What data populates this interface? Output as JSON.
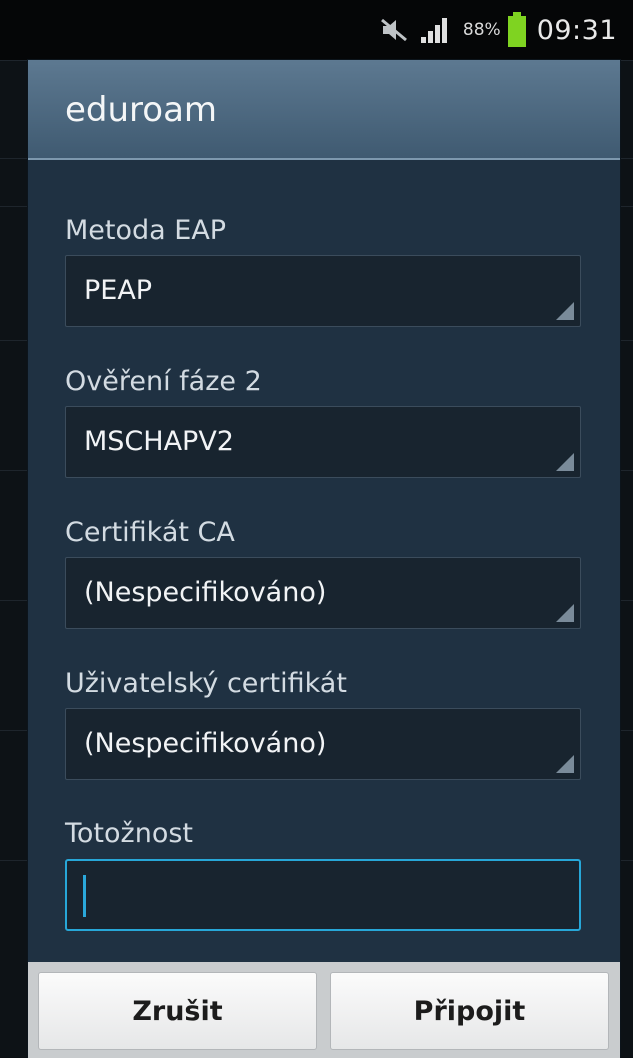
{
  "status_bar": {
    "battery_percent": "88%",
    "time": "09:31",
    "icons": [
      "mute-icon",
      "signal-icon",
      "battery-icon"
    ],
    "battery_color": "#7fd321"
  },
  "dialog": {
    "title": "eduroam",
    "fields": {
      "eap_method": {
        "label": "Metoda EAP",
        "value": "PEAP"
      },
      "phase2_auth": {
        "label": "Ověření fáze 2",
        "value": "MSCHAPV2"
      },
      "ca_certificate": {
        "label": "Certifikát CA",
        "value": "(Nespecifikováno)"
      },
      "user_certificate": {
        "label": "Uživatelský certifikát",
        "value": "(Nespecifikováno)"
      },
      "identity": {
        "label": "Totožnost",
        "value": "",
        "placeholder": ""
      }
    },
    "buttons": {
      "cancel": "Zrušit",
      "connect": "Připojit"
    }
  },
  "colors": {
    "dialog_bg": "#1f3142",
    "header_bg": "#4d6880",
    "focus_accent": "#27a7d8"
  }
}
